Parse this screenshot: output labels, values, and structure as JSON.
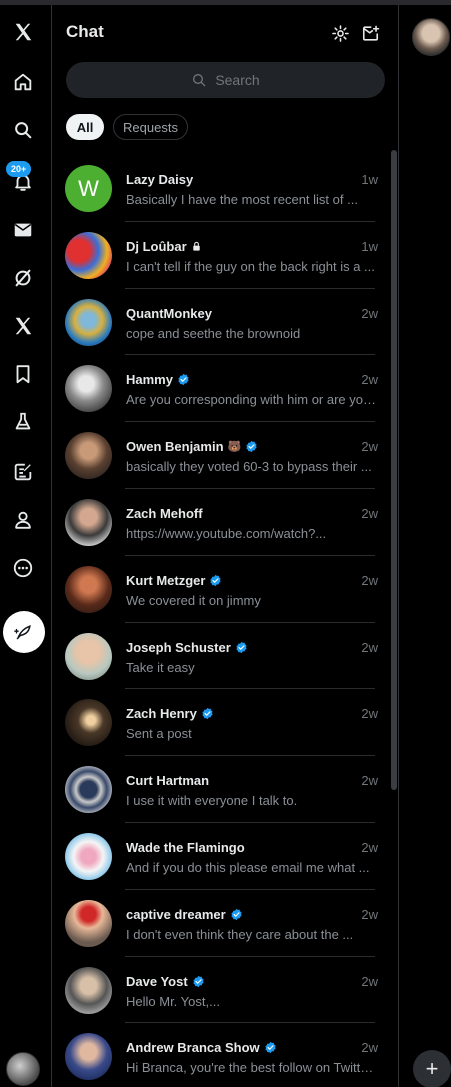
{
  "panel": {
    "title": "Chat",
    "search_placeholder": "Search"
  },
  "filters": {
    "all": "All",
    "requests": "Requests"
  },
  "nav": {
    "notifications_badge": "20+"
  },
  "new_button_label": "+",
  "colors": {
    "accent": "#1d9bf0",
    "background": "#000000",
    "muted_text": "#71767b"
  },
  "conversations": [
    {
      "name": "Lazy Daisy",
      "time": "1w",
      "preview": "Basically I have the most recent list of ...",
      "letter": "W",
      "verified": false,
      "locked": false,
      "emoji": ""
    },
    {
      "name": "Dj Loûbar",
      "time": "1w",
      "preview": "I can't tell if the guy on the back right is a ...",
      "letter": "",
      "verified": false,
      "locked": true,
      "emoji": ""
    },
    {
      "name": "QuantMonkey",
      "time": "2w",
      "preview": "cope and seethe the brownoid",
      "letter": "",
      "verified": false,
      "locked": false,
      "emoji": ""
    },
    {
      "name": "Hammy",
      "time": "2w",
      "preview": "Are you corresponding with him or are you...",
      "letter": "",
      "verified": true,
      "locked": false,
      "emoji": ""
    },
    {
      "name": "Owen Benjamin",
      "time": "2w",
      "preview": "basically they voted 60-3 to bypass their ...",
      "letter": "",
      "verified": true,
      "locked": false,
      "emoji": "🐻"
    },
    {
      "name": "Zach Mehoff",
      "time": "2w",
      "preview": "https://www.youtube.com/watch?...",
      "letter": "",
      "verified": false,
      "locked": false,
      "emoji": ""
    },
    {
      "name": "Kurt Metzger",
      "time": "2w",
      "preview": "We covered it on jimmy",
      "letter": "",
      "verified": true,
      "locked": false,
      "emoji": ""
    },
    {
      "name": "Joseph Schuster",
      "time": "2w",
      "preview": "Take it easy",
      "letter": "",
      "verified": true,
      "locked": false,
      "emoji": ""
    },
    {
      "name": "Zach Henry",
      "time": "2w",
      "preview": "Sent a post",
      "letter": "",
      "verified": true,
      "locked": false,
      "emoji": ""
    },
    {
      "name": "Curt Hartman",
      "time": "2w",
      "preview": "I use it with everyone I talk to.",
      "letter": "",
      "verified": false,
      "locked": false,
      "emoji": ""
    },
    {
      "name": "Wade the Flamingo",
      "time": "2w",
      "preview": "And if you do this please email me what ...",
      "letter": "",
      "verified": false,
      "locked": false,
      "emoji": ""
    },
    {
      "name": "captive dreamer",
      "time": "2w",
      "preview": "I don't even think they care about the ...",
      "letter": "",
      "verified": true,
      "locked": false,
      "emoji": ""
    },
    {
      "name": "Dave Yost",
      "time": "2w",
      "preview": "Hello Mr. Yost,...",
      "letter": "",
      "verified": true,
      "locked": false,
      "emoji": ""
    },
    {
      "name": "Andrew Branca Show",
      "time": "2w",
      "preview": "Hi Branca, you're the best follow on Twitte...",
      "letter": "",
      "verified": true,
      "locked": false,
      "emoji": ""
    }
  ]
}
